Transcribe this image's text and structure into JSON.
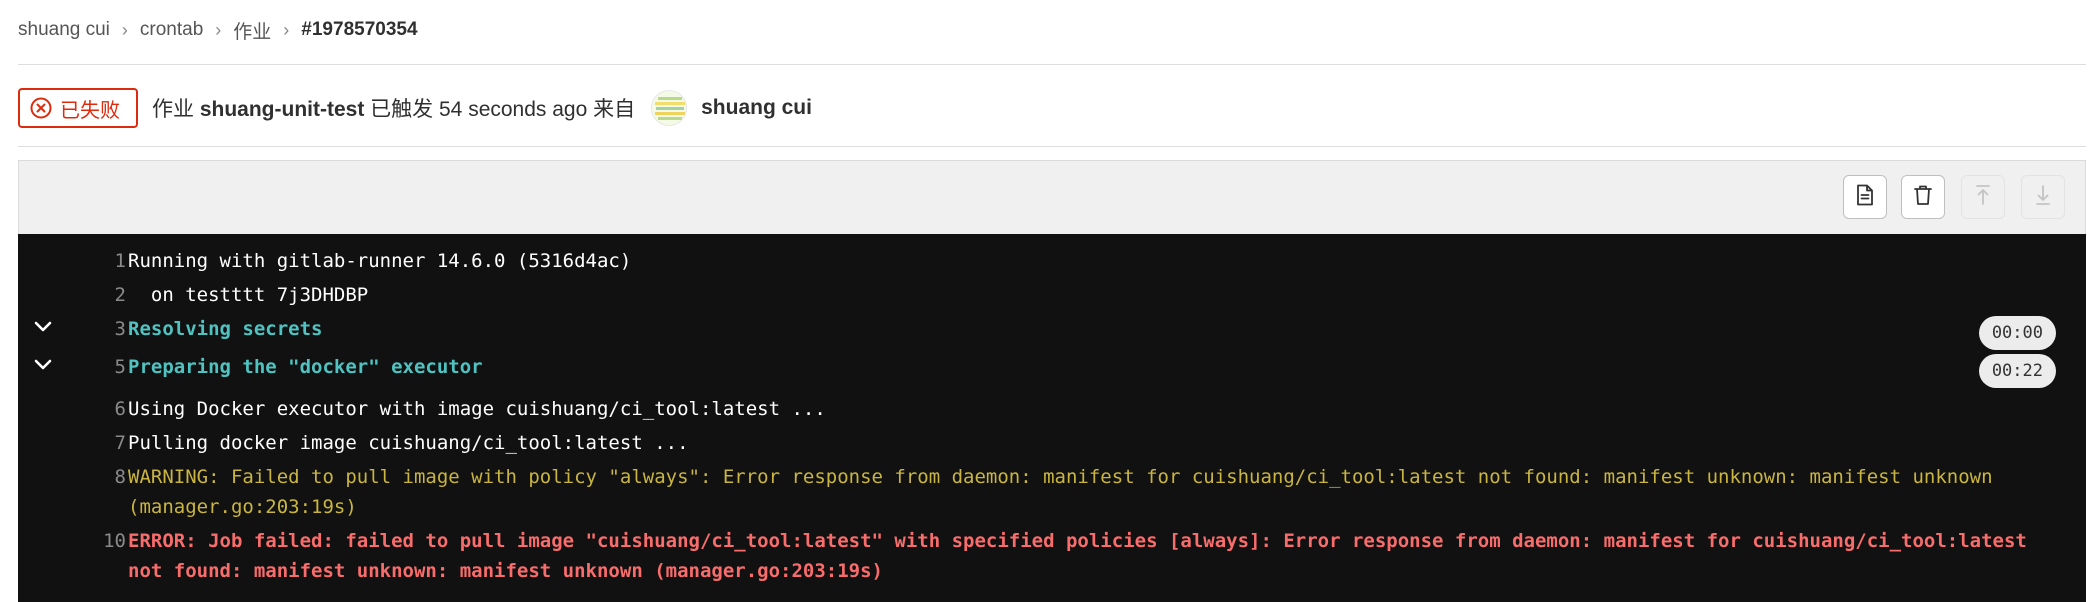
{
  "breadcrumb": {
    "items": [
      "shuang cui",
      "crontab",
      "作业"
    ],
    "current": "#1978570354",
    "separator": "›"
  },
  "header": {
    "status_label": "已失败",
    "job_prefix": "作业",
    "job_name": "shuang-unit-test",
    "triggered_text": "已触发 54 seconds ago 来自",
    "user_name": "shuang cui",
    "status_color": "#dd2b0e"
  },
  "toolbar": {
    "buttons": [
      "file-text-icon",
      "trash-icon",
      "scroll-to-top-icon",
      "scroll-to-bottom-icon"
    ]
  },
  "log": {
    "lines": [
      {
        "num": "1",
        "text": "Running with gitlab-runner 14.6.0 (5316d4ac)"
      },
      {
        "num": "2",
        "text": "  on testttt 7j3DHDBP"
      },
      {
        "num": "3",
        "text": "Resolving secrets",
        "duration": "00:00"
      },
      {
        "num": "5",
        "text": "Preparing the \"docker\" executor",
        "duration": "00:22"
      },
      {
        "num": "6",
        "text": "Using Docker executor with image cuishuang/ci_tool:latest ..."
      },
      {
        "num": "7",
        "text": "Pulling docker image cuishuang/ci_tool:latest ..."
      },
      {
        "num": "8",
        "text": "WARNING: Failed to pull image with policy \"always\": Error response from daemon: manifest for cuishuang/ci_tool:latest not found: manifest unknown: manifest unknown (manager.go:203:19s)"
      },
      {
        "num": "10",
        "text": "ERROR: Job failed: failed to pull image \"cuishuang/ci_tool:latest\" with specified policies [always]: Error response from daemon: manifest for cuishuang/ci_tool:latest not found: manifest unknown: manifest unknown (manager.go:203:19s)"
      }
    ],
    "colors": {
      "background": "#111111",
      "section": "#4fc3c1",
      "warning": "#c9b540",
      "error": "#f86c6c"
    }
  }
}
